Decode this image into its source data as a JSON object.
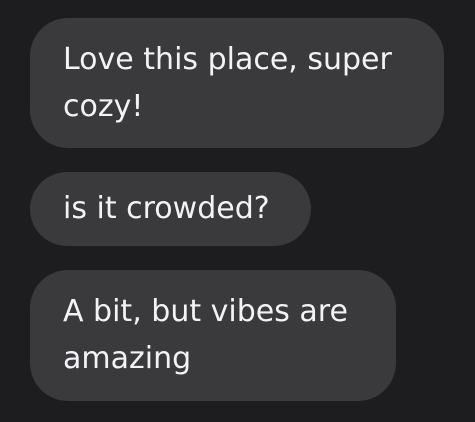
{
  "messages": [
    {
      "text": "Love this place, super cozy!"
    },
    {
      "text": "is it crowded?"
    },
    {
      "text": "A bit, but vibes are amazing"
    }
  ],
  "colors": {
    "background": "#1d1d1f",
    "bubble": "#3a3a3c",
    "text": "#f2f2f7"
  }
}
